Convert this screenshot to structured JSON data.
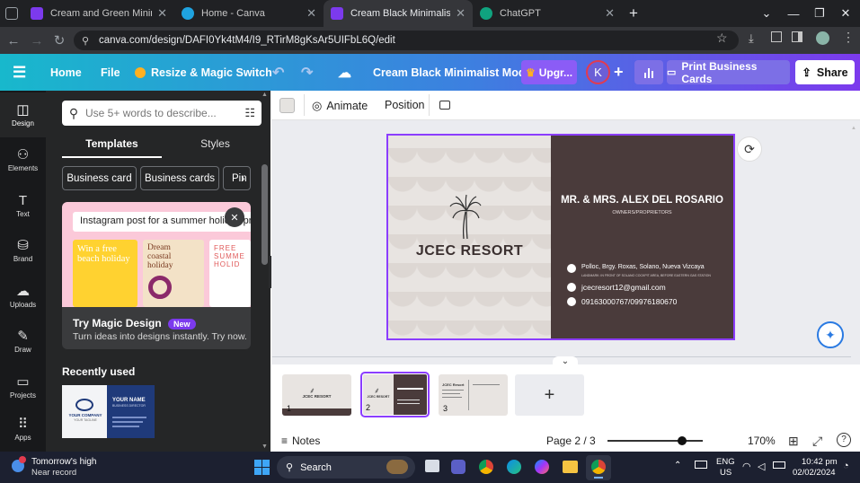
{
  "browser": {
    "tabs": [
      {
        "title": "Cream and Green Minimal Crea",
        "fav_color": "#7c3aed"
      },
      {
        "title": "Home - Canva",
        "fav_color": "#1fa3e0"
      },
      {
        "title": "Cream Black Minimalist Moder",
        "fav_color": "#7c3aed"
      },
      {
        "title": "ChatGPT",
        "fav_color": "#10a37f"
      }
    ],
    "url": "canva.com/design/DAFI0Yk4tM4/I9_RTirM8gKsAr5UIFbL6Q/edit"
  },
  "header": {
    "home": "Home",
    "file": "File",
    "resize": "Resize & Magic Switch",
    "doc_title": "Cream Black Minimalist Mod...",
    "upgrade": "Upgr...",
    "avatar": "K",
    "print": "Print Business Cards",
    "share": "Share"
  },
  "rail": [
    {
      "label": "Design",
      "icon": "design-icon"
    },
    {
      "label": "Elements",
      "icon": "elements-icon"
    },
    {
      "label": "Text",
      "icon": "text-icon"
    },
    {
      "label": "Brand",
      "icon": "brand-icon"
    },
    {
      "label": "Uploads",
      "icon": "uploads-icon"
    },
    {
      "label": "Draw",
      "icon": "draw-icon"
    },
    {
      "label": "Projects",
      "icon": "projects-icon"
    },
    {
      "label": "Apps",
      "icon": "apps-icon"
    }
  ],
  "panel": {
    "search_placeholder": "Use 5+ words to describe...",
    "tab_templates": "Templates",
    "tab_styles": "Styles",
    "chips": [
      "Business card",
      "Business cards",
      "Pin"
    ],
    "promo_prompt": "Instagram post for a summer holiday promo",
    "promo_cards": [
      "Win a free beach holiday",
      "Dream coastal holiday",
      "FREE SUMME HOLID"
    ],
    "promo_title": "Try Magic Design",
    "promo_badge": "New",
    "promo_sub": "Turn ideas into designs instantly. Try now.",
    "recent_heading": "Recently used",
    "recent_card": {
      "company": "YOUR COMPANY",
      "tagline": "YOUR TAGLINE",
      "name": "YOUR NAME",
      "role": "BUSINESS DIRECTOR"
    }
  },
  "toolbar": {
    "animate": "Animate",
    "position": "Position"
  },
  "card": {
    "resort": "JCEC RESORT",
    "names": "MR. & MRS. ALEX DEL ROSARIO",
    "role": "OWNERS/PROPRIETORS",
    "address": "Polloc, Brgy. Roxas, Solano, Nueva Vizcaya",
    "landmark": "LANDMARK: IN FRONT OF SOLANO COCKPIT AREA, BEFORE EASTERN GAS STATION",
    "email": "jcecresort12@gmail.com",
    "phone": "09163000767/09976180670",
    "bg_left": "#e8e4e1",
    "bg_right": "#4a3b3b"
  },
  "pages": {
    "thumbs": [
      {
        "num": "1",
        "label": "JCEC RESORT"
      },
      {
        "num": "2",
        "label": "JCEC RESORT"
      },
      {
        "num": "3",
        "label": "JCEC Resort"
      }
    ],
    "add": "+"
  },
  "footer": {
    "notes": "Notes",
    "page": "Page 2 / 3",
    "zoom": "170%",
    "zoom_level": 0.78
  },
  "taskbar": {
    "weather_1": "Tomorrow's high",
    "weather_2": "Near record",
    "search": "Search",
    "lang_1": "ENG",
    "lang_2": "US",
    "time": "10:42 pm",
    "date": "02/02/2024"
  }
}
